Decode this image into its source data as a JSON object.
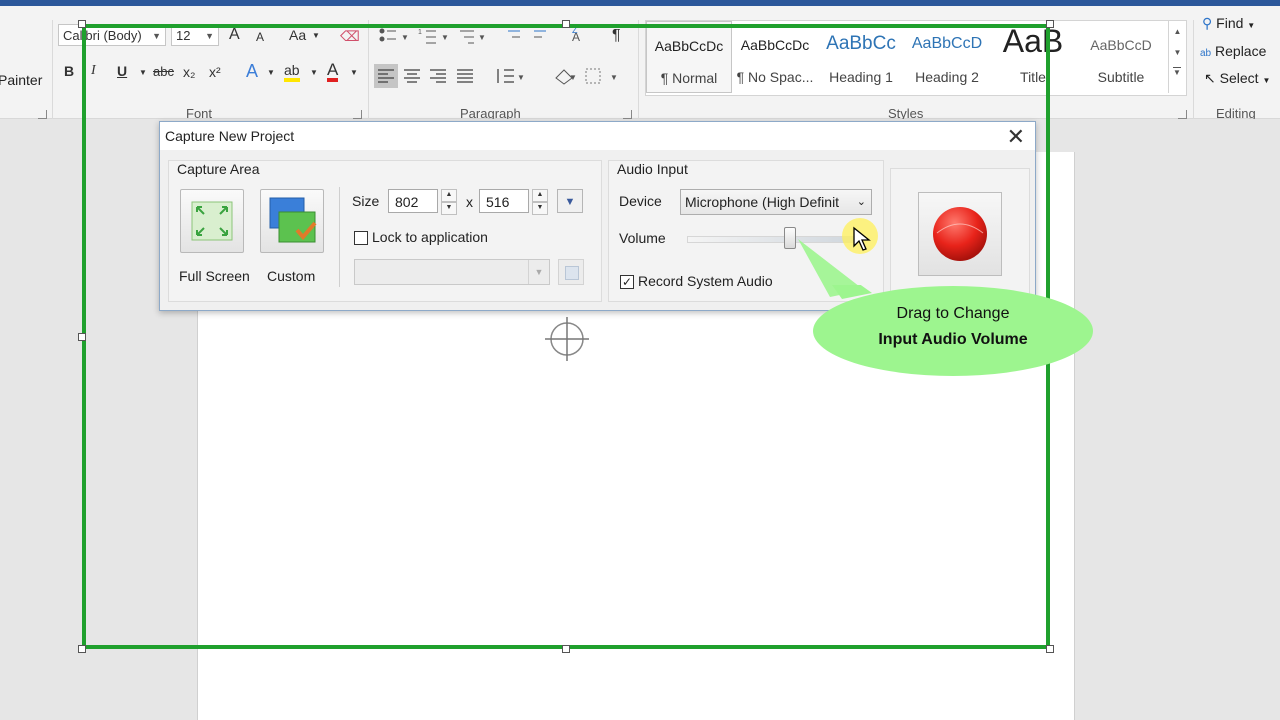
{
  "ribbon": {
    "format_painter_label": "Painter",
    "font": {
      "group_label": "Font",
      "font_name": "Calibri (Body)",
      "font_size": "12",
      "grow_glyph": "A",
      "shrink_glyph": "A",
      "change_case_glyph": "Aa",
      "bold": "B",
      "italic": "I",
      "underline": "U",
      "strikethrough": "abc",
      "subscript": "x₂",
      "superscript": "x²",
      "text_effects_glyph": "A",
      "font_color_glyph": "A",
      "highlight_glyph": "ab"
    },
    "paragraph": {
      "group_label": "Paragraph",
      "pilcrow": "¶"
    },
    "styles": {
      "group_label": "Styles",
      "items": [
        {
          "preview": "AaBbCcDc",
          "name": "¶ Normal"
        },
        {
          "preview": "AaBbCcDc",
          "name": "¶ No Spac..."
        },
        {
          "preview": "AaBbCc",
          "name": "Heading 1"
        },
        {
          "preview": "AaBbCcD",
          "name": "Heading 2"
        },
        {
          "preview": "AaB",
          "name": "Title"
        },
        {
          "preview": "AaBbCcD",
          "name": "Subtitle"
        }
      ]
    },
    "editing": {
      "group_label": "Editing",
      "find": "Find",
      "replace": "Replace",
      "select": "Select"
    }
  },
  "dialog": {
    "title": "Capture New Project",
    "capture_area": {
      "group_label": "Capture Area",
      "full_screen_label": "Full Screen",
      "custom_label": "Custom",
      "size_label": "Size",
      "width": "802",
      "x_separator": "x",
      "height": "516",
      "lock_label": "Lock to application",
      "lock_checked": false
    },
    "audio_input": {
      "group_label": "Audio Input",
      "device_label": "Device",
      "device_value": "Microphone (High Definit",
      "volume_label": "Volume",
      "volume_level": 0.6,
      "record_system_audio_label": "Record System Audio",
      "record_system_audio_checked": true
    }
  },
  "callout": {
    "line1": "Drag to Change",
    "line2": "Input Audio Volume"
  },
  "colors": {
    "frame": "#1fa02d",
    "record": "#e8231a",
    "callout": "#9df58f",
    "brand": "#2b579a"
  }
}
